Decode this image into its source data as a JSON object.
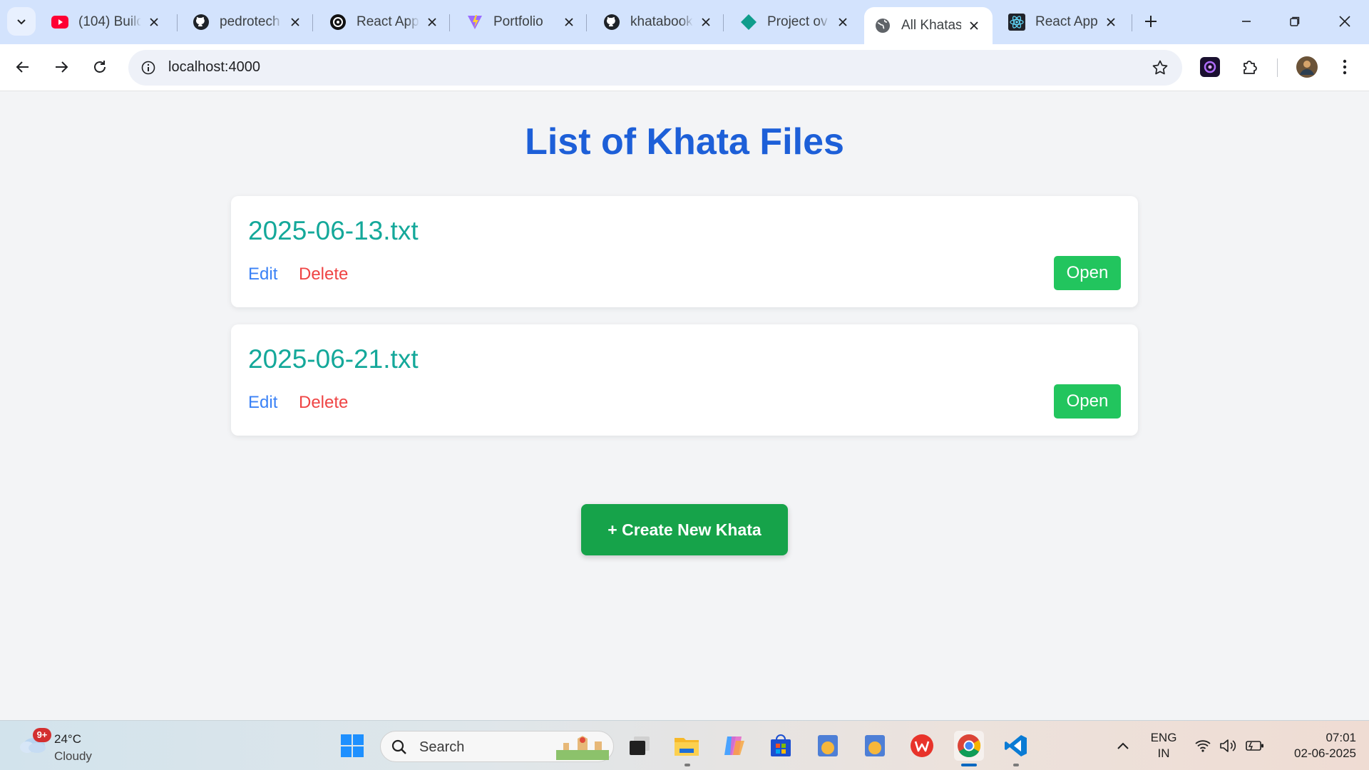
{
  "browser": {
    "tabs": [
      {
        "title": "(104) Build",
        "favicon": "youtube-icon",
        "active": false
      },
      {
        "title": "pedrotech",
        "favicon": "github-icon",
        "active": false
      },
      {
        "title": "React App",
        "favicon": "openai-icon",
        "active": false
      },
      {
        "title": "Portfolio",
        "favicon": "vite-icon",
        "active": false
      },
      {
        "title": "khatabook",
        "favicon": "github-icon",
        "active": false
      },
      {
        "title": "Project ov",
        "favicon": "diamond-icon",
        "active": false
      },
      {
        "title": "All Khatas",
        "favicon": "globe-icon",
        "active": true
      },
      {
        "title": "React App",
        "favicon": "react-icon",
        "active": false
      }
    ],
    "address": "localhost:4000"
  },
  "page": {
    "title": "List of Khata Files",
    "files": [
      {
        "name": "2025-06-13.txt",
        "edit_label": "Edit",
        "delete_label": "Delete",
        "open_label": "Open"
      },
      {
        "name": "2025-06-21.txt",
        "edit_label": "Edit",
        "delete_label": "Delete",
        "open_label": "Open"
      }
    ],
    "create_button": "+ Create New Khata"
  },
  "colors": {
    "title": "#1d5fd8",
    "filename": "#14a89a",
    "edit": "#3b82f6",
    "delete": "#ef4444",
    "open_button": "#22c55e",
    "create_button": "#16a34a"
  },
  "taskbar": {
    "weather": {
      "badge": "9+",
      "temperature": "24°C",
      "condition": "Cloudy"
    },
    "search_placeholder": "Search",
    "language": {
      "line1": "ENG",
      "line2": "IN"
    },
    "clock": {
      "time": "07:01",
      "date": "02-06-2025"
    }
  }
}
